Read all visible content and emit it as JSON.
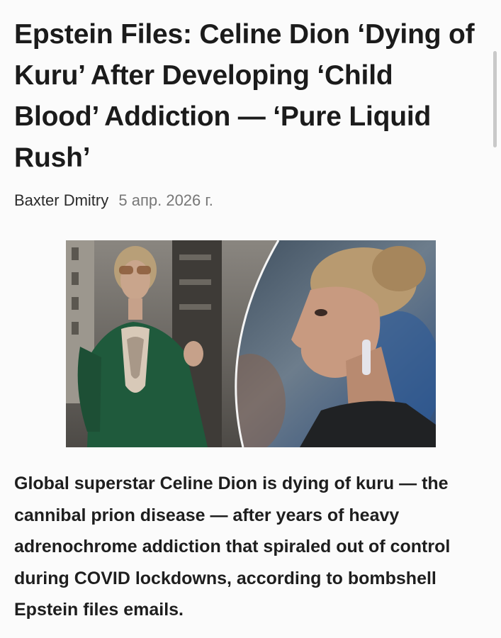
{
  "article": {
    "headline": "Epstein Files: Celine Dion ‘Dying of Kuru’ After Developing ‘Child Blood’ Addiction — ‘Pure Liquid Rush’",
    "author": "Baxter Dmitry",
    "date": "5 апр. 2026 г.",
    "lede": "Global superstar Celine Dion is dying of kuru — the cannibal prion disease — after years of heavy adrenochrome addiction that spiraled out of control during COVID lockdowns, according to bombshell Epstein files emails."
  },
  "colors": {
    "background": "#fbfbfb",
    "text": "#1b1b1b",
    "date": "#777777",
    "scrollbar": "#c9c9c9"
  }
}
